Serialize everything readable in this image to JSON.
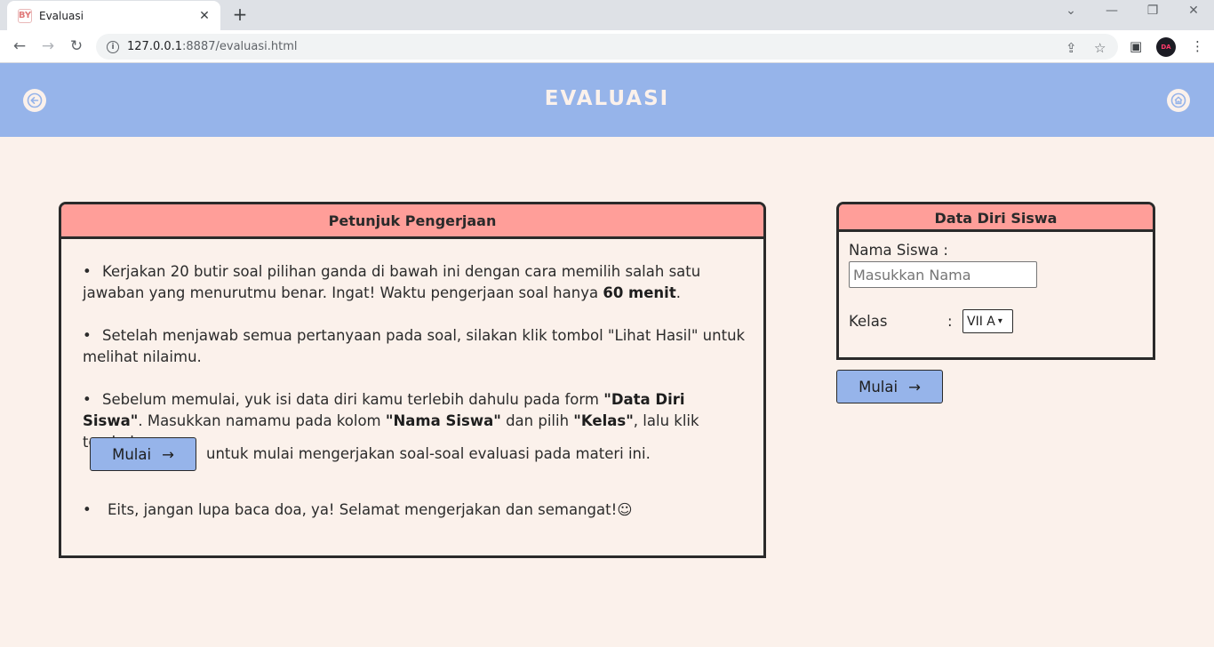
{
  "browser": {
    "tab_title": "Evaluasi",
    "favicon_text": "BY",
    "tab_close": "✕",
    "new_tab": "+",
    "url_host": "127.0.0.1",
    "url_rest": ":8887/evaluasi.html",
    "profile_initials": "DA"
  },
  "header": {
    "title": "EVALUASI"
  },
  "petunjuk": {
    "title": "Petunjuk Pengerjaan",
    "bullet": "•",
    "item1_text": "Kerjakan 20 butir soal pilihan ganda di bawah ini dengan cara memilih salah satu jawaban yang menurutmu benar. Ingat! Waktu pengerjaan soal hanya ",
    "item1_bold": "60 menit",
    "item1_end": ".",
    "item2_text": "Setelah menjawab semua pertanyaan pada soal, silakan klik tombol \"Lihat Hasil\" untuk melihat nilaimu.",
    "item3_a": "Sebelum memulai, yuk isi data diri kamu terlebih dahulu pada form ",
    "item3_bold1": "\"Data Diri Siswa\"",
    "item3_b": ". Masukkan namamu pada kolom ",
    "item3_bold2": "\"Nama Siswa\"",
    "item3_c": " dan pilih ",
    "item3_bold3": "\"Kelas\"",
    "item3_d": ", lalu klik tombol",
    "item3_after_button": "untuk mulai mengerjakan soal-soal evaluasi pada materi ini.",
    "item4_text": "Eits, jangan lupa baca doa, ya! Selamat mengerjakan dan semangat!☺",
    "inline_button_label": "Mulai",
    "arrow": "→"
  },
  "datadiri": {
    "title": "Data Diri Siswa",
    "nama_label": "Nama Siswa :",
    "nama_placeholder": "Masukkan Nama",
    "nama_value": "",
    "kelas_label": "Kelas",
    "kelas_colon": ":",
    "kelas_selected": "VII A",
    "start_button_label": "Mulai",
    "arrow": "→"
  },
  "colors": {
    "header_bg": "#96b4ea",
    "page_bg": "#fbf1eb",
    "card_head_bg": "#ff9e99",
    "button_bg": "#96b4ea"
  },
  "icons": {
    "back": "arrow-left-icon",
    "home": "home-icon"
  }
}
